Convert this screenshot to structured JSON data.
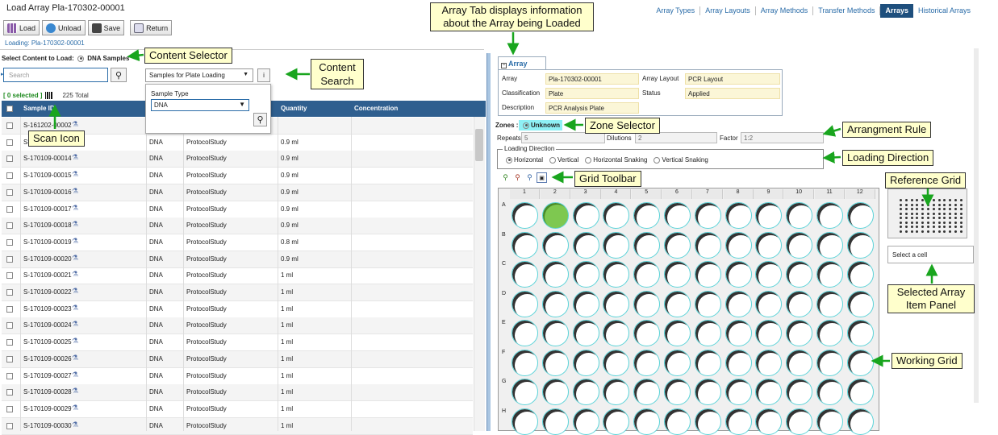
{
  "header": {
    "title": "Load Array Pla-170302-00001"
  },
  "topnav": [
    "Array Types",
    "Array Layouts",
    "Array Methods",
    "Transfer Methods",
    "Arrays",
    "Historical Arrays"
  ],
  "topnav_active": "Arrays",
  "toolbar": {
    "load": "Load",
    "unload": "Unload",
    "save": "Save",
    "return": "Return"
  },
  "loading_label": "Loading: Pla-170302-00001",
  "content_select": {
    "label": "Select Content to Load:",
    "option": "DNA Samples"
  },
  "search": {
    "placeholder": "Search"
  },
  "content_dropdown": {
    "value": "Samples for Plate Loading",
    "info": "i"
  },
  "sample_type": {
    "label": "Sample Type",
    "value": "DNA"
  },
  "selection": {
    "selected": "[ 0 selected ]",
    "total": "225 Total"
  },
  "grid": {
    "columns": [
      "Sample ID",
      "Quantity",
      "Concentration"
    ],
    "rows": [
      {
        "id": "S-161202-00002",
        "type": "",
        "project": "",
        "qty": ""
      },
      {
        "id": "S",
        "type": "DNA",
        "project": "ProtocolStudy",
        "qty": "0.9 ml"
      },
      {
        "id": "S-170109-00014",
        "type": "DNA",
        "project": "ProtocolStudy",
        "qty": "0.9 ml"
      },
      {
        "id": "S-170109-00015",
        "type": "DNA",
        "project": "ProtocolStudy",
        "qty": "0.9 ml"
      },
      {
        "id": "S-170109-00016",
        "type": "DNA",
        "project": "ProtocolStudy",
        "qty": "0.9 ml"
      },
      {
        "id": "S-170109-00017",
        "type": "DNA",
        "project": "ProtocolStudy",
        "qty": "0.9 ml"
      },
      {
        "id": "S-170109-00018",
        "type": "DNA",
        "project": "ProtocolStudy",
        "qty": "0.9 ml"
      },
      {
        "id": "S-170109-00019",
        "type": "DNA",
        "project": "ProtocolStudy",
        "qty": "0.8 ml"
      },
      {
        "id": "S-170109-00020",
        "type": "DNA",
        "project": "ProtocolStudy",
        "qty": "0.9 ml"
      },
      {
        "id": "S-170109-00021",
        "type": "DNA",
        "project": "ProtocolStudy",
        "qty": "1 ml"
      },
      {
        "id": "S-170109-00022",
        "type": "DNA",
        "project": "ProtocolStudy",
        "qty": "1 ml"
      },
      {
        "id": "S-170109-00023",
        "type": "DNA",
        "project": "ProtocolStudy",
        "qty": "1 ml"
      },
      {
        "id": "S-170109-00024",
        "type": "DNA",
        "project": "ProtocolStudy",
        "qty": "1 ml"
      },
      {
        "id": "S-170109-00025",
        "type": "DNA",
        "project": "ProtocolStudy",
        "qty": "1 ml"
      },
      {
        "id": "S-170109-00026",
        "type": "DNA",
        "project": "ProtocolStudy",
        "qty": "1 ml"
      },
      {
        "id": "S-170109-00027",
        "type": "DNA",
        "project": "ProtocolStudy",
        "qty": "1 ml"
      },
      {
        "id": "S-170109-00028",
        "type": "DNA",
        "project": "ProtocolStudy",
        "qty": "1 ml"
      },
      {
        "id": "S-170109-00029",
        "type": "DNA",
        "project": "ProtocolStudy",
        "qty": "1 ml"
      },
      {
        "id": "S-170109-00030",
        "type": "DNA",
        "project": "ProtocolStudy",
        "qty": "1 ml"
      }
    ]
  },
  "array_tab": {
    "label": "Array"
  },
  "array_fields": {
    "array_label": "Array",
    "array_value": "Pla-170302-00001",
    "layout_label": "Array Layout",
    "layout_value": "PCR Layout",
    "class_label": "Classification",
    "class_value": "Plate",
    "status_label": "Status",
    "status_value": "Applied",
    "desc_label": "Description",
    "desc_value": "PCR Analysis Plate"
  },
  "zones": {
    "label": "Zones :",
    "value": "Unknown"
  },
  "rule": {
    "repeats_label": "Repeats",
    "repeats_value": "5",
    "dilutions_label": "Dilutions",
    "dilutions_value": "2",
    "factor_label": "Factor",
    "factor_value": "1:2"
  },
  "loading_direction": {
    "title": "Loading Direction",
    "options": [
      "Horizontal",
      "Vertical",
      "Horizontal Snaking",
      "Vertical Snaking"
    ],
    "selected": "Horizontal"
  },
  "plate": {
    "columns": [
      "1",
      "2",
      "3",
      "4",
      "5",
      "6",
      "7",
      "8",
      "9",
      "10",
      "11",
      "12"
    ],
    "rows": [
      "A",
      "B",
      "C",
      "D",
      "E",
      "F",
      "G",
      "H"
    ],
    "selected_well": "A2"
  },
  "selected_item": {
    "placeholder": "Select a cell"
  },
  "callouts": {
    "array_tab": "Array Tab displays information about the Array being Loaded",
    "content_selector": "Content Selector",
    "content_search": "Content Search",
    "scan_icon": "Scan Icon",
    "zone_selector": "Zone Selector",
    "arrangement_rule": "Arrangment Rule",
    "loading_direction": "Loading Direction",
    "grid_toolbar": "Grid Toolbar",
    "reference_grid": "Reference Grid",
    "selected_item_panel": "Selected Array Item Panel",
    "working_grid": "Working Grid"
  }
}
